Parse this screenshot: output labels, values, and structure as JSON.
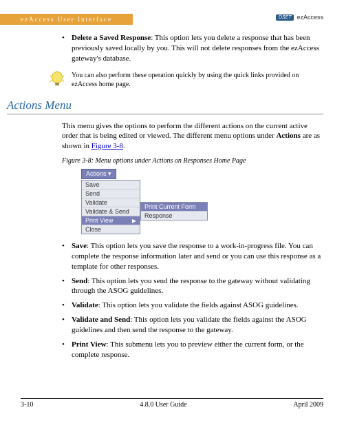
{
  "header": {
    "tab_text": "ezAccess User Interface",
    "logo_badge": "DSET",
    "logo_text": "ezAccess"
  },
  "delete_bullet": {
    "title": "Delete a Saved Response",
    "text": ": This option lets you delete a response that has been previously saved locally by you. This will not delete responses from the ezAccess gateway's database."
  },
  "tip": {
    "text": "You can also perform these operation quickly by using the quick links provided on ezAccess home page."
  },
  "section": {
    "heading": "Actions Menu",
    "intro_pre": "This menu gives the options to perform the different actions on the current active order that is being edited or viewed. The different menu options under ",
    "intro_bold": "Actions",
    "intro_post": " are as shown in ",
    "intro_link": "Figure 3-8",
    "intro_end": "."
  },
  "figure": {
    "caption": "Figure 3-8:  Menu options under Actions on Responses Home Page",
    "menu_button": "Actions ▾",
    "items": [
      "Save",
      "Send",
      "Validate",
      "Validate & Send",
      "Print View",
      "Close"
    ],
    "submenu": [
      "Print Current Form",
      "Response"
    ]
  },
  "bullets": [
    {
      "title": "Save",
      "text": ": This option lets you save the response to a work-in-progress file. You can complete the response information later and send or you can use this response as a template for other responses."
    },
    {
      "title": "Send",
      "text": ": This option lets you send the response to the gateway without validating through the ASOG guidelines."
    },
    {
      "title": "Validate",
      "text": ": This option lets you validate the fields against ASOG guidelines."
    },
    {
      "title": "Validate and Send",
      "text": ": This option lets you validate the fields against the ASOG guidelines and then send the response to the gateway."
    },
    {
      "title": "Print View",
      "text": ": This submenu lets you to preview either the current form, or the complete response."
    }
  ],
  "footer": {
    "left": "3-10",
    "center": "4.8.0 User Guide",
    "right": "April 2009"
  }
}
